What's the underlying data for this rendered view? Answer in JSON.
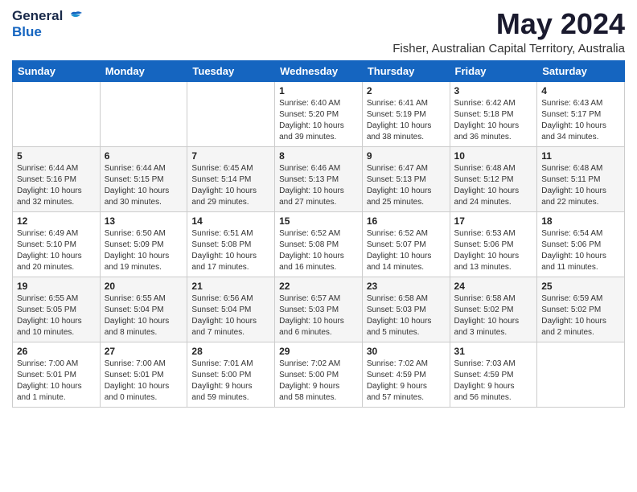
{
  "logo": {
    "general": "General",
    "blue": "Blue"
  },
  "title": "May 2024",
  "subtitle": "Fisher, Australian Capital Territory, Australia",
  "weekdays": [
    "Sunday",
    "Monday",
    "Tuesday",
    "Wednesday",
    "Thursday",
    "Friday",
    "Saturday"
  ],
  "weeks": [
    [
      {
        "day": "",
        "info": ""
      },
      {
        "day": "",
        "info": ""
      },
      {
        "day": "",
        "info": ""
      },
      {
        "day": "1",
        "info": "Sunrise: 6:40 AM\nSunset: 5:20 PM\nDaylight: 10 hours\nand 39 minutes."
      },
      {
        "day": "2",
        "info": "Sunrise: 6:41 AM\nSunset: 5:19 PM\nDaylight: 10 hours\nand 38 minutes."
      },
      {
        "day": "3",
        "info": "Sunrise: 6:42 AM\nSunset: 5:18 PM\nDaylight: 10 hours\nand 36 minutes."
      },
      {
        "day": "4",
        "info": "Sunrise: 6:43 AM\nSunset: 5:17 PM\nDaylight: 10 hours\nand 34 minutes."
      }
    ],
    [
      {
        "day": "5",
        "info": "Sunrise: 6:44 AM\nSunset: 5:16 PM\nDaylight: 10 hours\nand 32 minutes."
      },
      {
        "day": "6",
        "info": "Sunrise: 6:44 AM\nSunset: 5:15 PM\nDaylight: 10 hours\nand 30 minutes."
      },
      {
        "day": "7",
        "info": "Sunrise: 6:45 AM\nSunset: 5:14 PM\nDaylight: 10 hours\nand 29 minutes."
      },
      {
        "day": "8",
        "info": "Sunrise: 6:46 AM\nSunset: 5:13 PM\nDaylight: 10 hours\nand 27 minutes."
      },
      {
        "day": "9",
        "info": "Sunrise: 6:47 AM\nSunset: 5:13 PM\nDaylight: 10 hours\nand 25 minutes."
      },
      {
        "day": "10",
        "info": "Sunrise: 6:48 AM\nSunset: 5:12 PM\nDaylight: 10 hours\nand 24 minutes."
      },
      {
        "day": "11",
        "info": "Sunrise: 6:48 AM\nSunset: 5:11 PM\nDaylight: 10 hours\nand 22 minutes."
      }
    ],
    [
      {
        "day": "12",
        "info": "Sunrise: 6:49 AM\nSunset: 5:10 PM\nDaylight: 10 hours\nand 20 minutes."
      },
      {
        "day": "13",
        "info": "Sunrise: 6:50 AM\nSunset: 5:09 PM\nDaylight: 10 hours\nand 19 minutes."
      },
      {
        "day": "14",
        "info": "Sunrise: 6:51 AM\nSunset: 5:08 PM\nDaylight: 10 hours\nand 17 minutes."
      },
      {
        "day": "15",
        "info": "Sunrise: 6:52 AM\nSunset: 5:08 PM\nDaylight: 10 hours\nand 16 minutes."
      },
      {
        "day": "16",
        "info": "Sunrise: 6:52 AM\nSunset: 5:07 PM\nDaylight: 10 hours\nand 14 minutes."
      },
      {
        "day": "17",
        "info": "Sunrise: 6:53 AM\nSunset: 5:06 PM\nDaylight: 10 hours\nand 13 minutes."
      },
      {
        "day": "18",
        "info": "Sunrise: 6:54 AM\nSunset: 5:06 PM\nDaylight: 10 hours\nand 11 minutes."
      }
    ],
    [
      {
        "day": "19",
        "info": "Sunrise: 6:55 AM\nSunset: 5:05 PM\nDaylight: 10 hours\nand 10 minutes."
      },
      {
        "day": "20",
        "info": "Sunrise: 6:55 AM\nSunset: 5:04 PM\nDaylight: 10 hours\nand 8 minutes."
      },
      {
        "day": "21",
        "info": "Sunrise: 6:56 AM\nSunset: 5:04 PM\nDaylight: 10 hours\nand 7 minutes."
      },
      {
        "day": "22",
        "info": "Sunrise: 6:57 AM\nSunset: 5:03 PM\nDaylight: 10 hours\nand 6 minutes."
      },
      {
        "day": "23",
        "info": "Sunrise: 6:58 AM\nSunset: 5:03 PM\nDaylight: 10 hours\nand 5 minutes."
      },
      {
        "day": "24",
        "info": "Sunrise: 6:58 AM\nSunset: 5:02 PM\nDaylight: 10 hours\nand 3 minutes."
      },
      {
        "day": "25",
        "info": "Sunrise: 6:59 AM\nSunset: 5:02 PM\nDaylight: 10 hours\nand 2 minutes."
      }
    ],
    [
      {
        "day": "26",
        "info": "Sunrise: 7:00 AM\nSunset: 5:01 PM\nDaylight: 10 hours\nand 1 minute."
      },
      {
        "day": "27",
        "info": "Sunrise: 7:00 AM\nSunset: 5:01 PM\nDaylight: 10 hours\nand 0 minutes."
      },
      {
        "day": "28",
        "info": "Sunrise: 7:01 AM\nSunset: 5:00 PM\nDaylight: 9 hours\nand 59 minutes."
      },
      {
        "day": "29",
        "info": "Sunrise: 7:02 AM\nSunset: 5:00 PM\nDaylight: 9 hours\nand 58 minutes."
      },
      {
        "day": "30",
        "info": "Sunrise: 7:02 AM\nSunset: 4:59 PM\nDaylight: 9 hours\nand 57 minutes."
      },
      {
        "day": "31",
        "info": "Sunrise: 7:03 AM\nSunset: 4:59 PM\nDaylight: 9 hours\nand 56 minutes."
      },
      {
        "day": "",
        "info": ""
      }
    ]
  ]
}
